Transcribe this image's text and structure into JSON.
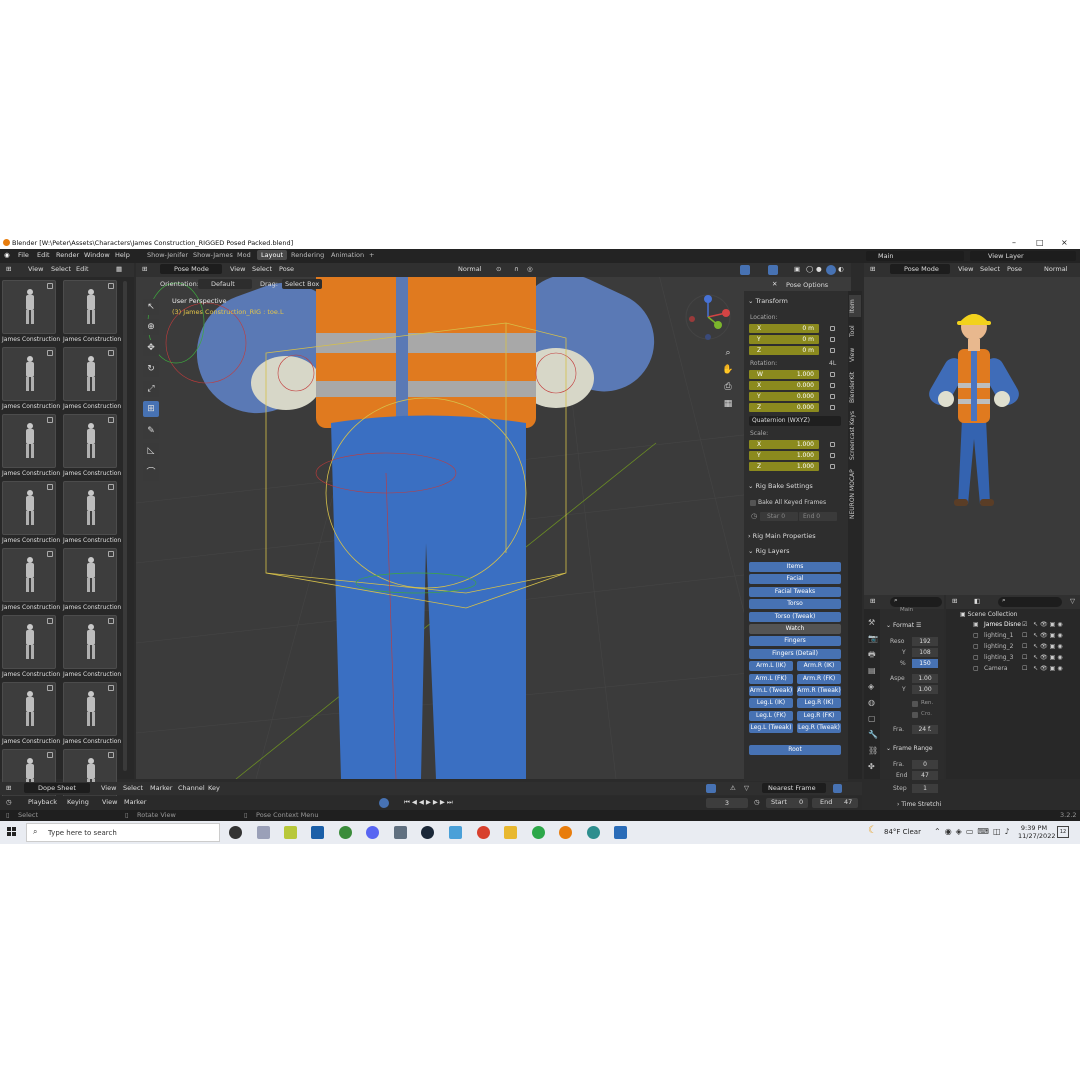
{
  "window": {
    "title": "Blender [W:\\Peter\\Assets\\Characters\\James Construction_RIGGED Posed Packed.blend]",
    "minimize": "–",
    "maximize": "□",
    "close": "×"
  },
  "menubar": {
    "items": [
      "File",
      "Edit",
      "Render",
      "Window",
      "Help"
    ],
    "workspaces": [
      "Show-Jenifer",
      "Show-James",
      "Mod",
      "Layout",
      "Rendering",
      "Animation"
    ],
    "add_tab": "+",
    "scene": "Main",
    "view_layer": "View Layer"
  },
  "asset_browser": {
    "menu": [
      "View",
      "Select",
      "Edit"
    ],
    "items": [
      "James Construction",
      "James Construction",
      "James Construction",
      "James Construction",
      "James Construction",
      "James Construction",
      "James Construction",
      "James Construction",
      "James Construction",
      "James Construction",
      "James Construction",
      "James Construction",
      "James Construction",
      "James Construction",
      "James Construction"
    ]
  },
  "viewport": {
    "mode": "Pose Mode",
    "menu": [
      "View",
      "Select",
      "Pose"
    ],
    "orientation_label": "Orientation:",
    "orientation": "Default",
    "drag_label": "Drag:",
    "drag": "Select Box",
    "shading": "Normal",
    "pose_options": "Pose Options",
    "perspective": "User Perspective",
    "active_info": "(3) James Construction_RIG : toe.L"
  },
  "n_panel": {
    "tabs": [
      "Item",
      "Tool",
      "View",
      "BlenderKit",
      "Screencast Keys",
      "NEURON MOCAP"
    ],
    "transform_title": "Transform",
    "location_label": "Location:",
    "location": [
      {
        "axis": "X",
        "value": "0 m"
      },
      {
        "axis": "Y",
        "value": "0 m"
      },
      {
        "axis": "Z",
        "value": "0 m"
      }
    ],
    "rotation_label": "Rotation:",
    "rotation_mode_short": "4L",
    "rotation": [
      {
        "axis": "W",
        "value": "1.000"
      },
      {
        "axis": "X",
        "value": "0.000"
      },
      {
        "axis": "Y",
        "value": "0.000"
      },
      {
        "axis": "Z",
        "value": "0.000"
      }
    ],
    "rotation_mode": "Quaternion (WXYZ)",
    "scale_label": "Scale:",
    "scale": [
      {
        "axis": "X",
        "value": "1.000"
      },
      {
        "axis": "Y",
        "value": "1.000"
      },
      {
        "axis": "Z",
        "value": "1.000"
      }
    ],
    "rig_bake_title": "Rig Bake Settings",
    "bake_all": "Bake All Keyed Frames",
    "bake_start": "Star  0",
    "bake_end": "End  0",
    "rig_main_title": "Rig Main Properties",
    "rig_layers_title": "Rig Layers",
    "layers_full": [
      "Items",
      "Facial",
      "Facial Tweaks",
      "Torso",
      "Torso (Tweak)",
      "Watch",
      "Fingers",
      "Fingers (Detail)"
    ],
    "layers_pairs": [
      [
        "Arm.L (IK)",
        "Arm.R (IK)"
      ],
      [
        "Arm.L (FK)",
        "Arm.R (FK)"
      ],
      [
        "Arm.L (Tweak)",
        "Arm.R (Tweak)"
      ],
      [
        "Leg.L (IK)",
        "Leg.R (IK)"
      ],
      [
        "Leg.L (FK)",
        "Leg.R (FK)"
      ],
      [
        "Leg.L (Tweak)",
        "Leg.R (Tweak)"
      ]
    ],
    "root": "Root"
  },
  "preview": {
    "mode": "Pose Mode",
    "menu": [
      "View",
      "Select",
      "Pose"
    ],
    "shading": "Normal"
  },
  "properties": {
    "search_placeholder": "",
    "main_label": "Main",
    "format": "Format",
    "reso_label": "Reso",
    "res_x": "192",
    "res_y_label": "Y",
    "res_y": "108",
    "pct_label": "%",
    "pct": "150",
    "aspect_label": "Aspe",
    "aspect_x": "1.00",
    "aspect_y_label": "Y",
    "aspect_y": "1.00",
    "render_region": "Ren.",
    "crop": "Cro.",
    "fps_label": "Fra.",
    "fps": "24 f.",
    "frame_range": "Frame Range",
    "frame_start_label": "Fra.",
    "frame_start": "0",
    "end_label": "End",
    "end": "47",
    "step_label": "Step",
    "step": "1",
    "time_stretch": "Time Stretchi"
  },
  "outliner": {
    "title": "Scene Collection",
    "items": [
      "James Disne",
      "lighting_1",
      "lighting_2",
      "lighting_3",
      "Camera"
    ]
  },
  "dopesheet": {
    "editor": "Dope Sheet",
    "menu": [
      "View",
      "Select",
      "Marker",
      "Channel",
      "Key"
    ],
    "snap": "Nearest Frame"
  },
  "timeline": {
    "menu": [
      "Playback",
      "Keying",
      "View",
      "Marker"
    ],
    "current": "3",
    "start_label": "Start",
    "start": "0",
    "end_label": "End",
    "end": "47"
  },
  "statusbar": {
    "select": "Select",
    "rotate": "Rotate View",
    "context": "Pose Context Menu",
    "version": "3.2.2"
  },
  "taskbar": {
    "search": "Type here to search",
    "weather": "84°F  Clear",
    "time": "9:39 PM",
    "date": "11/27/2022",
    "notif": "12"
  }
}
